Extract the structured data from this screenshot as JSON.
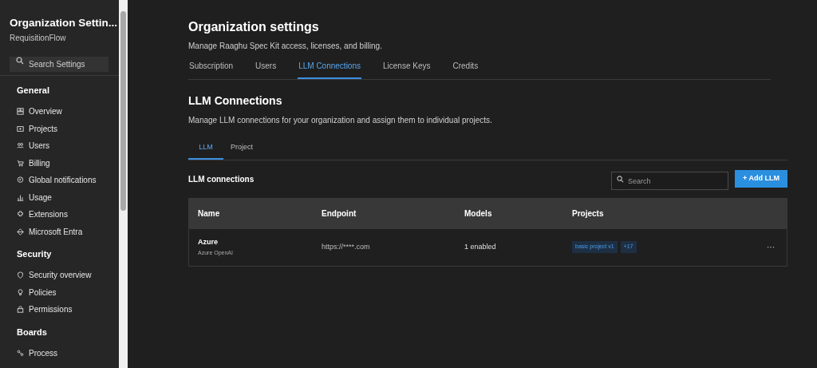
{
  "sidebar": {
    "title": "Organization Settin...",
    "subtitle": "RequisitionFlow",
    "search": {
      "placeholder": "Search Settings"
    },
    "sections": [
      {
        "heading": "General",
        "items": [
          {
            "label": "Overview"
          },
          {
            "label": "Projects"
          },
          {
            "label": "Users"
          },
          {
            "label": "Billing"
          },
          {
            "label": "Global notifications"
          },
          {
            "label": "Usage"
          },
          {
            "label": "Extensions"
          },
          {
            "label": "Microsoft Entra"
          }
        ]
      },
      {
        "heading": "Security",
        "items": [
          {
            "label": "Security overview"
          },
          {
            "label": "Policies"
          },
          {
            "label": "Permissions"
          }
        ]
      },
      {
        "heading": "Boards",
        "items": [
          {
            "label": "Process"
          }
        ]
      }
    ]
  },
  "header": {
    "title": "Organization settings",
    "subtitle": "Manage Raaghu Spec Kit access, licenses, and billing."
  },
  "tabs": [
    {
      "label": "Subscription",
      "selected": false
    },
    {
      "label": "Users",
      "selected": false
    },
    {
      "label": "LLM Connections",
      "selected": true
    },
    {
      "label": "License Keys",
      "selected": false
    },
    {
      "label": "Credits",
      "selected": false
    }
  ],
  "section": {
    "title": "LLM Connections",
    "description": "Manage LLM connections for your organization and assign them to individual projects."
  },
  "subtabs": [
    {
      "label": "LLM",
      "selected": true
    },
    {
      "label": "Project",
      "selected": false
    }
  ],
  "toolbar": {
    "title": "LLM connections",
    "search": {
      "placeholder": "Search"
    },
    "add_button": "+ Add LLM"
  },
  "table": {
    "columns": [
      "Name",
      "Endpoint",
      "Models",
      "Projects"
    ],
    "rows": [
      {
        "name": "Azure",
        "provider": "Azure OpenAI",
        "endpoint": "https://****.com",
        "models": "1 enabled",
        "projects": [
          "basic project v1",
          "+17"
        ],
        "menu": "···"
      }
    ]
  }
}
